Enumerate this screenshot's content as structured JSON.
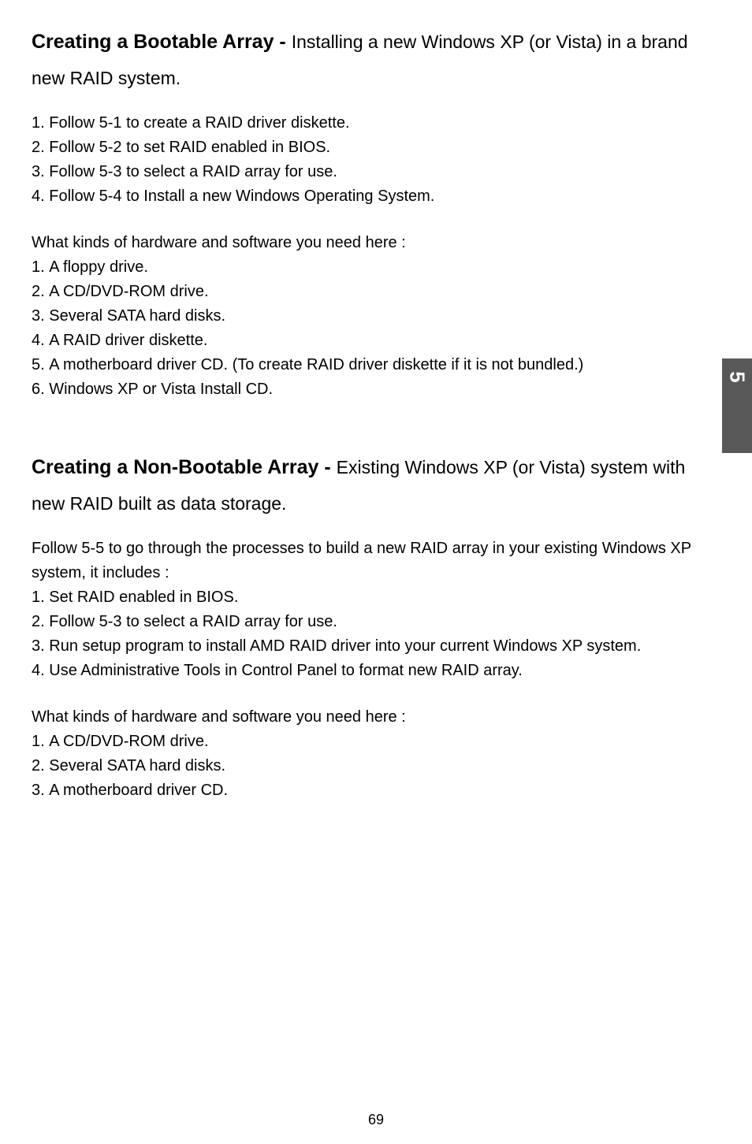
{
  "side_tab": "5",
  "page_number": "69",
  "section1": {
    "lead": "Creating a Bootable Array - ",
    "rest": "Installing a new Windows XP (or Vista) in a brand new RAID system.",
    "steps": [
      "Follow 5-1 to create a RAID driver diskette.",
      "Follow 5-2 to set RAID enabled in BIOS.",
      "Follow 5-3 to select a RAID array for use.",
      "Follow 5-4 to Install a new Windows Operating System."
    ],
    "needs_intro": "What kinds of hardware and software you need here :",
    "needs": [
      "A floppy drive.",
      "A CD/DVD-ROM drive.",
      "Several SATA hard disks.",
      "A RAID driver diskette.",
      "A motherboard driver CD. (To create RAID driver diskette if it is not bundled.)",
      "Windows XP or Vista Install CD."
    ]
  },
  "section2": {
    "lead": "Creating a Non-Bootable Array - ",
    "rest": "Existing Windows XP (or Vista) system with new RAID built as data storage.",
    "intro": "Follow 5-5 to go through the processes to build a new RAID array in your existing Windows XP system, it includes :",
    "steps": [
      "Set RAID enabled in BIOS.",
      "Follow 5-3 to select a RAID array for use.",
      "Run setup program to install AMD RAID driver into your current Windows XP system.",
      "Use Administrative Tools in Control Panel to format new RAID array."
    ],
    "needs_intro": "What kinds of hardware and software you need here :",
    "needs": [
      "A CD/DVD-ROM drive.",
      "Several SATA hard disks.",
      "A motherboard driver CD."
    ]
  }
}
